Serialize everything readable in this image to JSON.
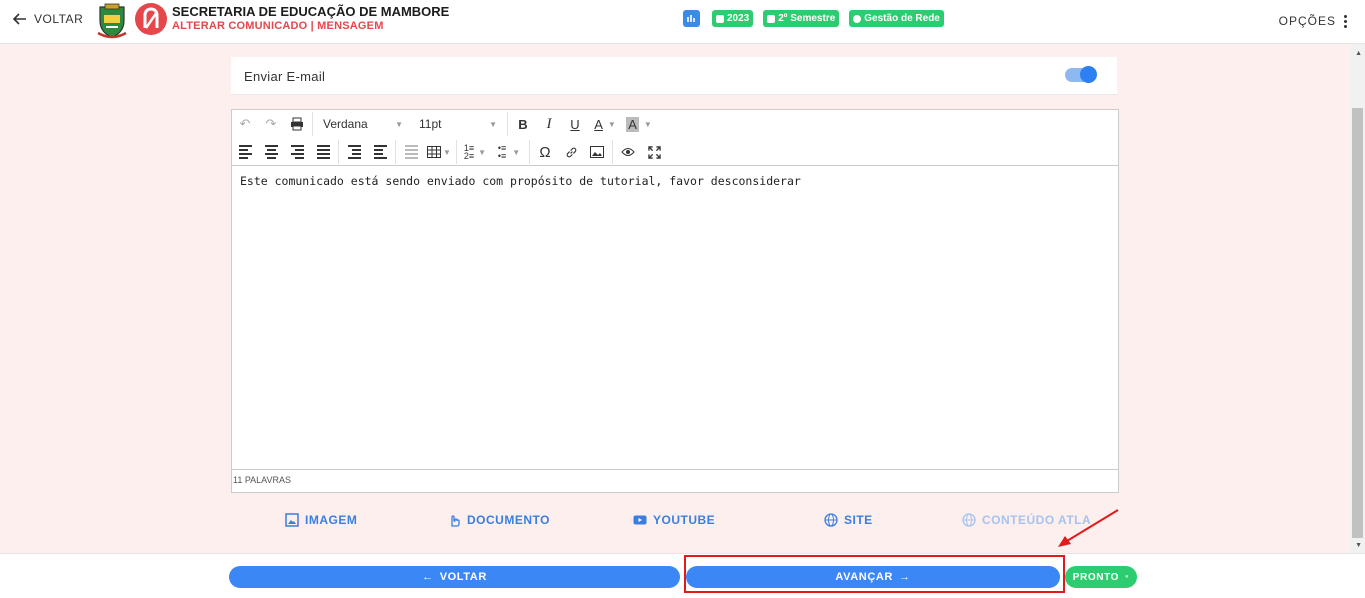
{
  "header": {
    "back_label": "VOLTAR",
    "org_title": "SECRETARIA DE EDUCAÇÃO DE MAMBORE",
    "page_subtitle": "ALTERAR COMUNICADO | MENSAGEM",
    "chips": [
      "2023",
      "2º Semestre",
      "Gestão de Rede"
    ],
    "options_label": "OPÇÕES"
  },
  "email": {
    "label": "Enviar E-mail",
    "enabled": true
  },
  "editor": {
    "font_family": "Verdana",
    "font_size": "11pt",
    "content": "Este comunicado está sendo enviado com propósito de tutorial, favor desconsiderar",
    "word_count": "11 PALAVRAS"
  },
  "attachments": {
    "image_label": "IMAGEM",
    "document_label": "DOCUMENTO",
    "youtube_label": "YOUTUBE",
    "site_label": "SITE",
    "atla_label": "CONTEÚDO ATLA"
  },
  "footer": {
    "back_label": "VOLTAR",
    "next_label": "AVANÇAR",
    "done_label": "PRONTO"
  },
  "colors": {
    "primary": "#3a87f5",
    "success": "#2ecc71",
    "brand_red": "#e5474b",
    "page_bg": "#fcefee",
    "annotation": "#e01b1b"
  }
}
